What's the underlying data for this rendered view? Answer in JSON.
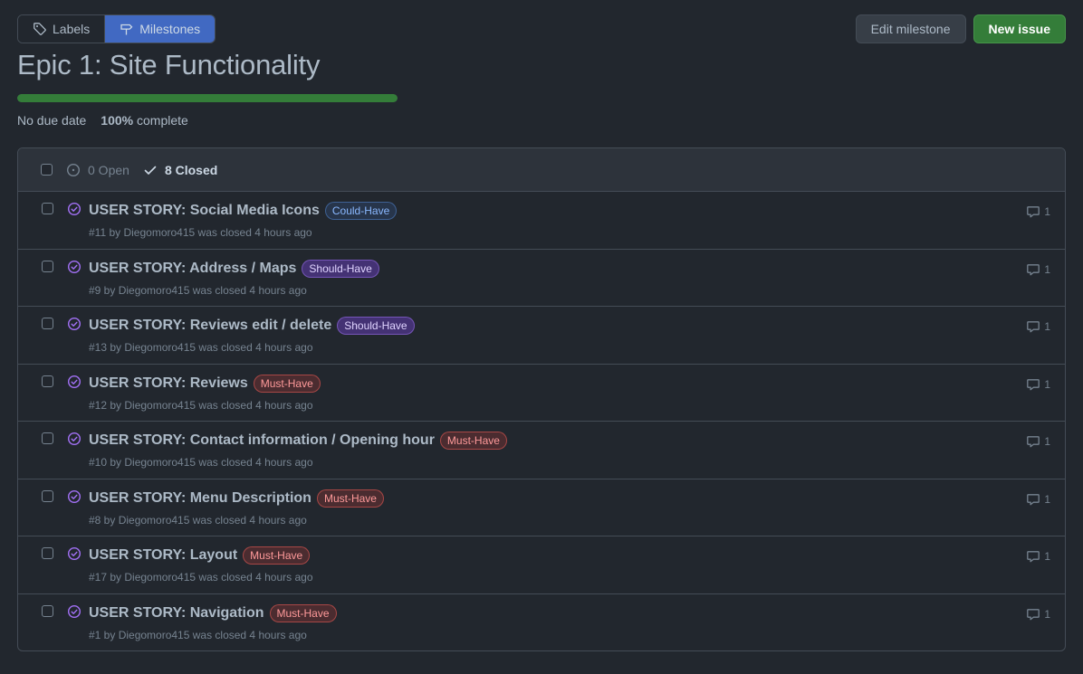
{
  "nav": {
    "labels_tab": "Labels",
    "milestones_tab": "Milestones"
  },
  "actions": {
    "edit_milestone": "Edit milestone",
    "new_issue": "New issue"
  },
  "milestone": {
    "title": "Epic 1: Site Functionality",
    "due": "No due date",
    "percent": "100%",
    "complete_suffix": "complete",
    "progress": 1.0
  },
  "filters": {
    "open": "0 Open",
    "closed": "8 Closed"
  },
  "issues": [
    {
      "title": "USER STORY: Social Media Icons",
      "label": "Could-Have",
      "label_kind": "could",
      "sub": "#11 by Diegomoro415 was closed 4 hours ago",
      "comments": "1"
    },
    {
      "title": "USER STORY: Address / Maps",
      "label": "Should-Have",
      "label_kind": "should",
      "sub": "#9 by Diegomoro415 was closed 4 hours ago",
      "comments": "1"
    },
    {
      "title": "USER STORY: Reviews edit / delete",
      "label": "Should-Have",
      "label_kind": "should",
      "sub": "#13 by Diegomoro415 was closed 4 hours ago",
      "comments": "1"
    },
    {
      "title": "USER STORY: Reviews",
      "label": "Must-Have",
      "label_kind": "must",
      "sub": "#12 by Diegomoro415 was closed 4 hours ago",
      "comments": "1"
    },
    {
      "title": "USER STORY: Contact information / Opening hour",
      "label": "Must-Have",
      "label_kind": "must",
      "sub": "#10 by Diegomoro415 was closed 4 hours ago",
      "comments": "1"
    },
    {
      "title": "USER STORY: Menu Description",
      "label": "Must-Have",
      "label_kind": "must",
      "sub": "#8 by Diegomoro415 was closed 4 hours ago",
      "comments": "1"
    },
    {
      "title": "USER STORY: Layout",
      "label": "Must-Have",
      "label_kind": "must",
      "sub": "#17 by Diegomoro415 was closed 4 hours ago",
      "comments": "1"
    },
    {
      "title": "USER STORY: Navigation",
      "label": "Must-Have",
      "label_kind": "must",
      "sub": "#1 by Diegomoro415 was closed 4 hours ago",
      "comments": "1"
    }
  ],
  "colors": {
    "accent_blue": "#4169c2",
    "success_green": "#347d39",
    "closed_purple": "#a371f7"
  }
}
